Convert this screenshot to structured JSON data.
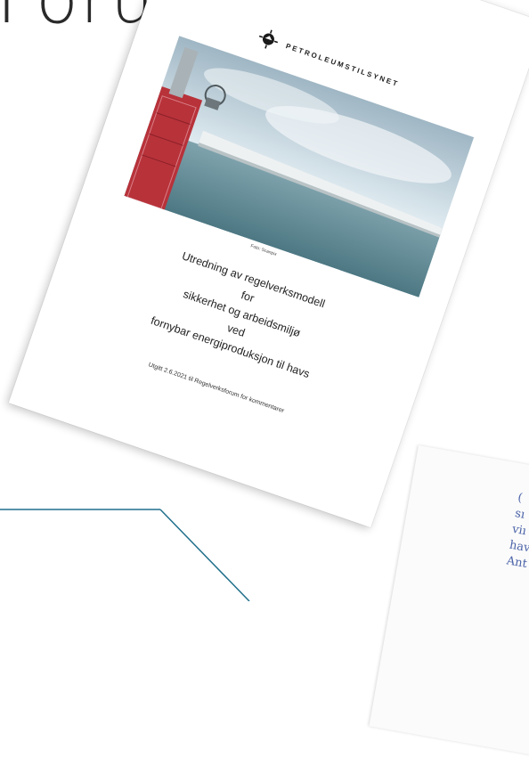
{
  "slide": {
    "title": "Forum"
  },
  "document": {
    "logo_text": "PETROLEUMSTILSYNET",
    "photo_credit": "Foto: Scanpix",
    "title_lines": [
      "Utredning av regelverksmodell",
      "for",
      "sikkerhet og arbeidsmiljø",
      "ved",
      "fornybar energiproduksjon til havs"
    ],
    "published": "Utgitt 2.6.2021 til Regelverksforum for kommentarer"
  },
  "back_page": {
    "lines": [
      "(",
      "sı",
      "viı",
      "hav",
      "Ant"
    ]
  },
  "colors": {
    "accent_line": "#1f6f8b",
    "back_text": "#4a62a8",
    "turbine_tower": "#b8323a"
  }
}
